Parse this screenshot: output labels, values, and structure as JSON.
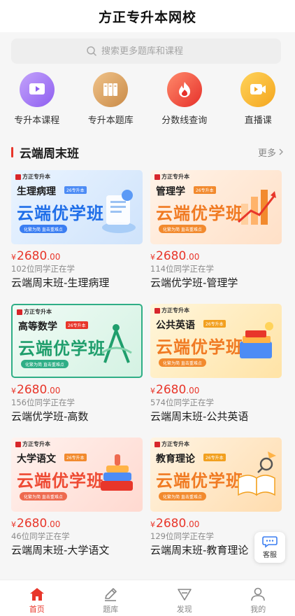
{
  "header": {
    "title": "方正专升本网校"
  },
  "search": {
    "placeholder": "搜索更多题库和课程"
  },
  "categories": [
    {
      "label": "专升本课程",
      "icon": "video-icon",
      "color": "#a77bf0"
    },
    {
      "label": "专升本题库",
      "icon": "books-icon",
      "color": "#e0a25b"
    },
    {
      "label": "分数线查询",
      "icon": "flame-icon",
      "color": "#ef4e3a"
    },
    {
      "label": "直播课",
      "icon": "live-icon",
      "color": "#f7b52c"
    }
  ],
  "section": {
    "title": "云端周末班",
    "more": "更多"
  },
  "courses": [
    {
      "thumb_subject": "生理病理",
      "thumb_tag": "26专升本",
      "thumb_title": "云端优学班",
      "thumb_slogan": "化繁为简   直击重难点",
      "currency": "¥",
      "price_int": "2680",
      "price_dec": ".00",
      "learners": "102位同学正在学",
      "name": "云端周末班-生理病理"
    },
    {
      "thumb_subject": "管理学",
      "thumb_tag": "26专升本",
      "thumb_title": "云端优学班",
      "thumb_slogan": "化繁为简   直击重难点",
      "currency": "¥",
      "price_int": "2680",
      "price_dec": ".00",
      "learners": "114位同学正在学",
      "name": "云端优学班-管理学"
    },
    {
      "thumb_subject": "高等数学",
      "thumb_tag": "26专升本",
      "thumb_title": "云端优学班",
      "thumb_slogan": "化繁为简   直击重难点",
      "currency": "¥",
      "price_int": "2680",
      "price_dec": ".00",
      "learners": "156位同学正在学",
      "name": "云端优学班-高数"
    },
    {
      "thumb_subject": "公共英语",
      "thumb_tag": "26专升本",
      "thumb_title": "云端优学班",
      "thumb_slogan": "化繁为简   直击重难点",
      "currency": "¥",
      "price_int": "2680",
      "price_dec": ".00",
      "learners": "574位同学正在学",
      "name": "云端周末班-公共英语"
    },
    {
      "thumb_subject": "大学语文",
      "thumb_tag": "26专升本",
      "thumb_title": "云端优学班",
      "thumb_slogan": "化繁为简   直击重难点",
      "currency": "¥",
      "price_int": "2680",
      "price_dec": ".00",
      "learners": "46位同学正在学",
      "name": "云端周末班-大学语文"
    },
    {
      "thumb_subject": "教育理论",
      "thumb_tag": "26专升本",
      "thumb_title": "云端优学班",
      "thumb_slogan": "化繁为简   直击重难点",
      "currency": "¥",
      "price_int": "2680",
      "price_dec": ".00",
      "learners": "129位同学正在学",
      "name": "云端周末班-教育理论"
    }
  ],
  "thumb_brand": "方正专升本",
  "customer_service": {
    "label": "客服"
  },
  "tabs": [
    {
      "label": "首页",
      "icon": "home-icon",
      "active": true
    },
    {
      "label": "题库",
      "icon": "pencil-icon",
      "active": false
    },
    {
      "label": "发现",
      "icon": "discover-icon",
      "active": false
    },
    {
      "label": "我的",
      "icon": "user-icon",
      "active": false
    }
  ],
  "colors": {
    "accent": "#e8362a",
    "selected_border": "#2fae86"
  }
}
